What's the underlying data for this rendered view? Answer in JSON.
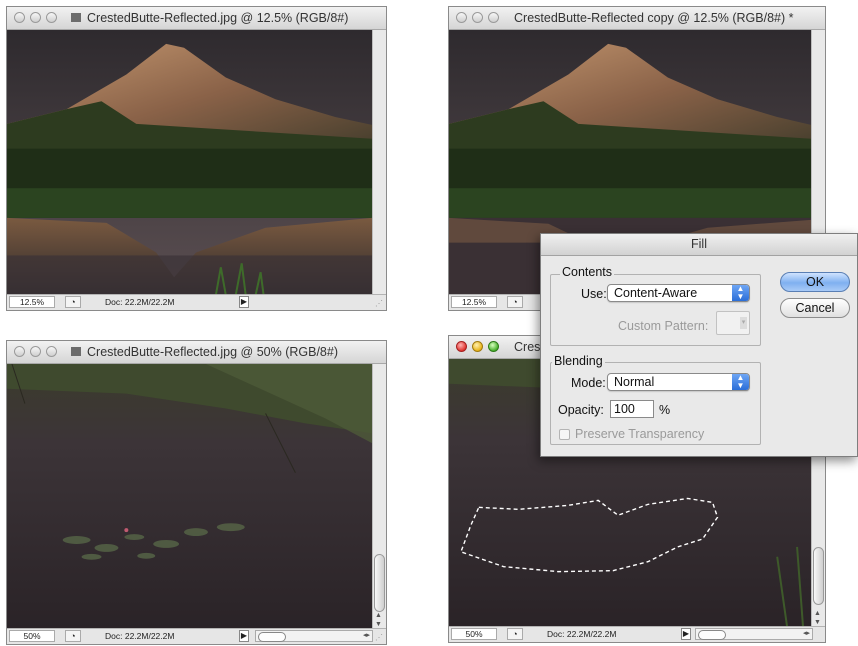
{
  "windows": {
    "top_left": {
      "title": "CrestedButte-Reflected.jpg @ 12.5% (RGB/8#)",
      "zoom": "12.5%",
      "doc_info": "Doc: 22.2M/22.2M"
    },
    "top_right": {
      "title": "CrestedButte-Reflected copy @ 12.5% (RGB/8#) *",
      "zoom": "12.5%"
    },
    "bottom_left": {
      "title": "CrestedButte-Reflected.jpg @ 50% (RGB/8#)",
      "zoom": "50%",
      "doc_info": "Doc: 22.2M/22.2M"
    },
    "bottom_right": {
      "title_visible": "Cres",
      "zoom": "50%",
      "doc_info": "Doc: 22.2M/22.2M"
    }
  },
  "fill_dialog": {
    "title": "Fill",
    "contents_group": "Contents",
    "use_label": "Use:",
    "use_value": "Content-Aware",
    "custom_pattern_label": "Custom Pattern:",
    "blending_group": "Blending",
    "mode_label": "Mode:",
    "mode_value": "Normal",
    "opacity_label": "Opacity:",
    "opacity_value": "100",
    "opacity_unit": "%",
    "preserve_transparency_label": "Preserve Transparency",
    "preserve_transparency_checked": false,
    "ok_label": "OK",
    "cancel_label": "Cancel"
  },
  "colors": {
    "ok_button": "#7fb0f0",
    "popup_arrow": "#2b6ed8",
    "selection_marquee": "#ffffff"
  }
}
